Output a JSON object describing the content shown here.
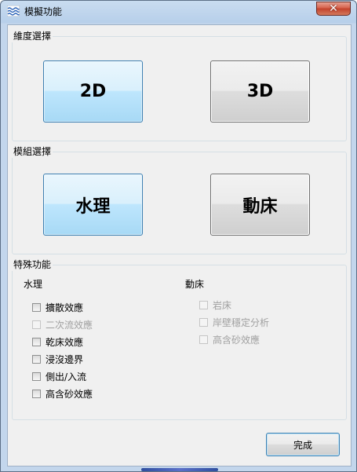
{
  "window": {
    "title": "模擬功能",
    "close_glyph": "✕"
  },
  "dimension_group": {
    "label": "維度選擇",
    "btn_2d": "2D",
    "btn_3d": "3D",
    "selected": "2D"
  },
  "module_group": {
    "label": "模組選擇",
    "btn_water": "水理",
    "btn_bed": "動床",
    "selected": "水理"
  },
  "special_group": {
    "label": "特殊功能",
    "water_title": "水理",
    "water_options": [
      {
        "label": "擴散效應",
        "checked": false,
        "enabled": true
      },
      {
        "label": "二次流效應",
        "checked": false,
        "enabled": false
      },
      {
        "label": "乾床效應",
        "checked": false,
        "enabled": true
      },
      {
        "label": "浸沒邊界",
        "checked": false,
        "enabled": true
      },
      {
        "label": "側出/入流",
        "checked": false,
        "enabled": true
      },
      {
        "label": "高含砂效應",
        "checked": false,
        "enabled": true
      }
    ],
    "bed_title": "動床",
    "bed_options": [
      {
        "label": "岩床",
        "checked": false,
        "enabled": false
      },
      {
        "label": "岸壁穩定分析",
        "checked": false,
        "enabled": false
      },
      {
        "label": "高含砂效應",
        "checked": false,
        "enabled": false
      }
    ]
  },
  "footer": {
    "done_label": "完成"
  },
  "icons": {
    "app": "waves-icon",
    "close": "close-icon"
  },
  "colors": {
    "selected_button": "#bee6fd",
    "normal_button": "#dddddd",
    "frame": "#c3d6ec",
    "close_button": "#c3422c"
  }
}
